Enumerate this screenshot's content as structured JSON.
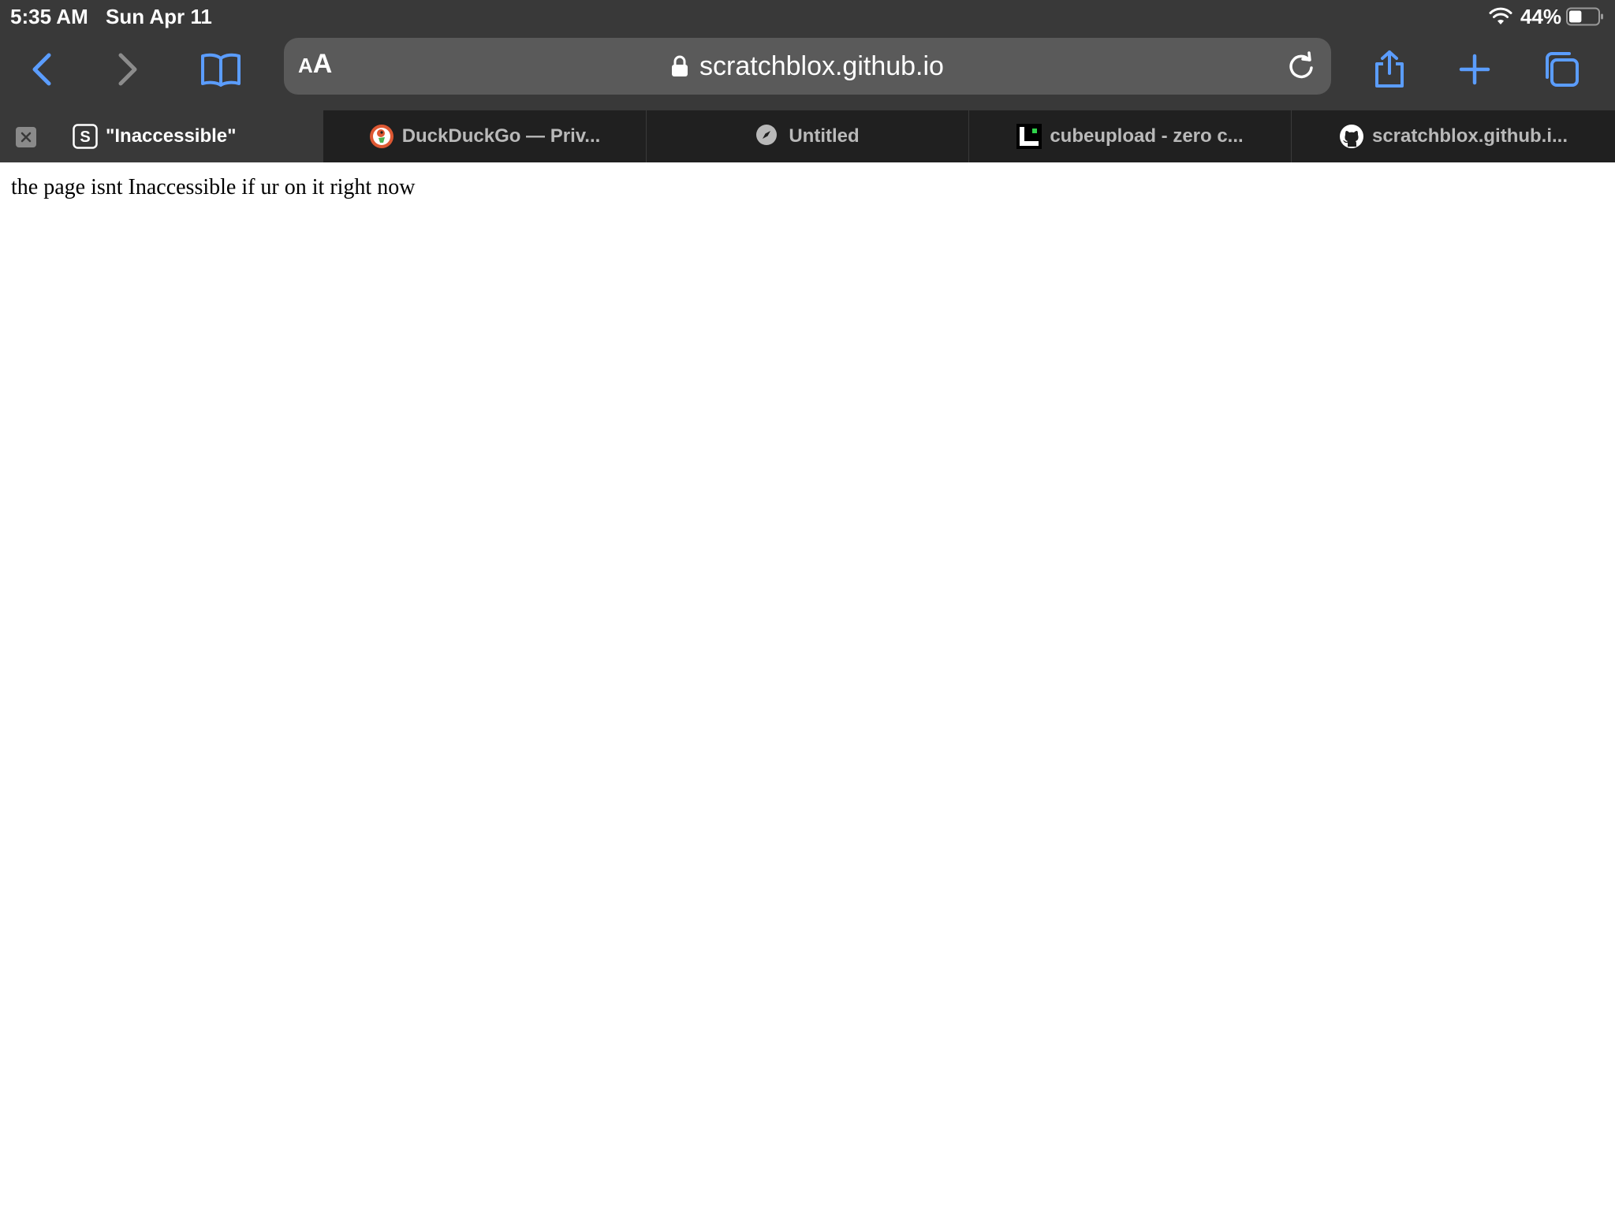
{
  "status_bar": {
    "time": "5:35 AM",
    "date": "Sun Apr 11",
    "battery_percent": "44%",
    "battery_level": 0.44
  },
  "toolbar": {
    "aa_small": "A",
    "aa_large": "A",
    "url": "scratchblox.github.io",
    "accent_color": "#5b9dff"
  },
  "tabs": [
    {
      "label": "\"Inaccessible\"",
      "favicon": "s-letter-icon",
      "active": true
    },
    {
      "label": "DuckDuckGo — Priv...",
      "favicon": "duckduckgo-icon",
      "active": false
    },
    {
      "label": "Untitled",
      "favicon": "compass-icon",
      "active": false
    },
    {
      "label": "cubeupload - zero c...",
      "favicon": "cubeupload-icon",
      "active": false
    },
    {
      "label": "scratchblox.github.i...",
      "favicon": "github-icon",
      "active": false
    }
  ],
  "page": {
    "body_text": "the page isnt Inaccessible if ur on it right now"
  }
}
